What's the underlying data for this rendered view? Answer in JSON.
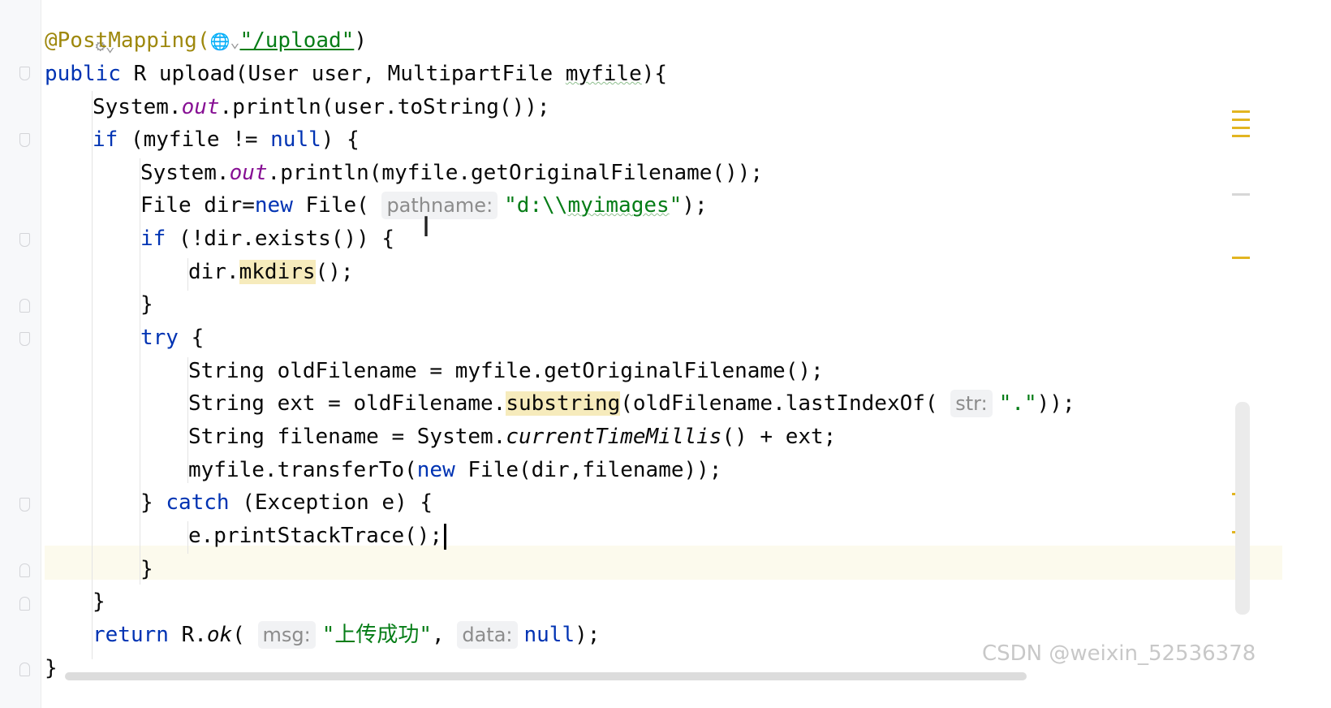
{
  "editor": {
    "annotation": "@PostMapping(",
    "annotation_path": "\"/upload\"",
    "annotation_close": ")",
    "lines": {
      "l2_a": "public",
      "l2_b": " R ",
      "l2_c": "upload(User user, MultipartFile ",
      "l2_d": "myfile",
      "l2_e": "){",
      "l3_a": "System.",
      "l3_b": "out",
      "l3_c": ".println(user.toString());",
      "l4_a": "if",
      "l4_b": " (myfile != ",
      "l4_c": "null",
      "l4_d": ") {",
      "l5_a": "System.",
      "l5_b": "out",
      "l5_c": ".println(myfile.getOriginalFilename());",
      "l6_a": "File dir=",
      "l6_b": "new",
      "l6_c": " File( ",
      "l6_hint": "pathname:",
      "l6_d": "\"d:\\\\",
      "l6_e": "myimages",
      "l6_f": "\"",
      "l6_g": ");",
      "l7_a": "if",
      "l7_b": " (!dir.exists()) {",
      "l8_a": "dir.",
      "l8_b": "mkdirs",
      "l8_c": "();",
      "l9": "}",
      "l10_a": "try",
      "l10_b": " {",
      "l11": "String oldFilename = myfile.getOriginalFilename();",
      "l12_a": "String ext = oldFilename.",
      "l12_b": "substring",
      "l12_c": "(oldFilename.lastIndexOf( ",
      "l12_hint": "str:",
      "l12_d": "\".\"",
      "l12_e": "));",
      "l13_a": "String filename = System.",
      "l13_b": "currentTimeMillis",
      "l13_c": "() + ext;",
      "l14_a": "myfile.transferTo(",
      "l14_b": "new",
      "l14_c": " File(dir,filename));",
      "l15_a": "} ",
      "l15_b": "catch",
      "l15_c": " (Exception e) {",
      "l16": "e.printStackTrace();",
      "l17": "}",
      "l18": "}",
      "l19_a": "return",
      "l19_b": " R.",
      "l19_c": "ok",
      "l19_d": "( ",
      "l19_hint1": "msg:",
      "l19_e": "\"上传成功\"",
      "l19_f": ", ",
      "l19_hint2": "data:",
      "l19_g": "null",
      "l19_h": ");",
      "l20": "}"
    }
  },
  "watermark": "CSDN @weixin_52536378",
  "colors": {
    "keyword": "#0033b3",
    "annotation": "#9e880d",
    "string": "#067d17",
    "static_field": "#871094",
    "caret_line_bg": "#fcfaed",
    "warning_marker": "#e2b521"
  }
}
